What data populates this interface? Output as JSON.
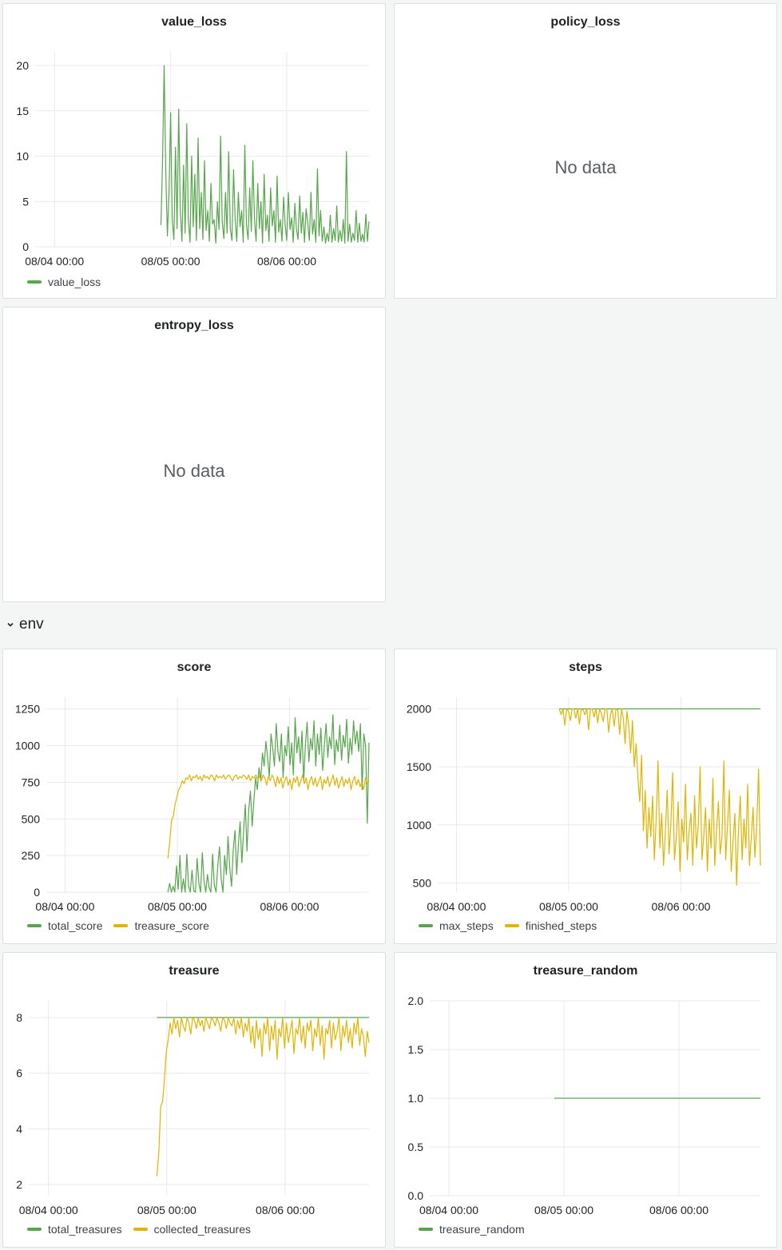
{
  "row": {
    "title": "env",
    "chevron_icon": "chevron-down-icon"
  },
  "no_data_text": "No data",
  "colors": {
    "green": "#56a64b",
    "yellow": "#e0b400",
    "grid": "#e9e9ea",
    "tick": "#202226"
  },
  "panels": [
    {
      "id": "value_loss",
      "title": "value_loss",
      "nodata": false,
      "chart_data": {
        "type": "line",
        "title": "value_loss",
        "xlabel": "",
        "ylabel": "",
        "x_ticks": [
          "08/04 00:00",
          "08/05 00:00",
          "08/06 00:00"
        ],
        "x_range": [
          "2023-08-03 20:00",
          "2023-08-06 17:00"
        ],
        "y_ticks": [
          "0",
          "5",
          "10",
          "15",
          "20"
        ],
        "ylim": [
          0,
          21.5
        ],
        "series": [
          {
            "name": "value_loss",
            "color": "#56a64b",
            "x_range": [
              "2023-08-04 22:00",
              "2023-08-06 17:00"
            ],
            "values": [
              2.4,
              9.5,
              20,
              8,
              1.2,
              6,
              14.8,
              3,
              0.8,
              11,
              2,
              15.2,
              4,
              0.6,
              9,
              1.5,
              13.6,
              3,
              0.5,
              10,
              2.2,
              8,
              0.7,
              12,
              2,
              6,
              0.8,
              9.5,
              1.8,
              4,
              0.6,
              7,
              2.5,
              3,
              0.4,
              5,
              1.9,
              12.2,
              2.8,
              0.9,
              6,
              1.5,
              10.5,
              2,
              0.7,
              8.5,
              3,
              0.6,
              6,
              2.2,
              4,
              0.5,
              11.2,
              2.5,
              0.8,
              6.5,
              1.7,
              9.5,
              3,
              0.6,
              7,
              2,
              5,
              0.4,
              8,
              1.8,
              3.5,
              0.6,
              6.5,
              2.3,
              4,
              0.5,
              7.8,
              1.6,
              3,
              0.6,
              5.5,
              2.4,
              0.7,
              6,
              1.9,
              3.2,
              0.5,
              4.8,
              2,
              0.8,
              5.6,
              1.5,
              3.8,
              0.5,
              4.2,
              2.6,
              0.7,
              6,
              1.4,
              3,
              0.5,
              8.6,
              1.2,
              4,
              0.6,
              2.2,
              0.4,
              1.5,
              0.6,
              3.5,
              0.5,
              2,
              0.7,
              4.5,
              0.5,
              1.8,
              0.6,
              3,
              0.4,
              10.5,
              0.6,
              2.5,
              0.5,
              1.5,
              0.7,
              4,
              0.5,
              2.6,
              0.6,
              1.4,
              0.5,
              3.6,
              0.6,
              2.8
            ]
          }
        ],
        "legend": [
          "value_loss"
        ],
        "grid": true
      }
    },
    {
      "id": "policy_loss",
      "title": "policy_loss",
      "nodata": true
    },
    {
      "id": "entropy_loss",
      "title": "entropy_loss",
      "nodata": true
    },
    {
      "id": "score",
      "title": "score",
      "nodata": false,
      "chart_data": {
        "type": "line",
        "title": "score",
        "xlabel": "",
        "ylabel": "",
        "x_ticks": [
          "08/04 00:00",
          "08/05 00:00",
          "08/06 00:00"
        ],
        "x_range": [
          "2023-08-03 20:00",
          "2023-08-06 17:00"
        ],
        "y_ticks": [
          "0",
          "250",
          "500",
          "750",
          "1000",
          "1250"
        ],
        "ylim": [
          0,
          1330
        ],
        "series": [
          {
            "name": "total_score",
            "color": "#56a64b",
            "x_range": [
              "2023-08-04 22:00",
              "2023-08-06 17:00"
            ],
            "values": [
              0,
              60,
              0,
              40,
              0,
              180,
              20,
              250,
              0,
              90,
              0,
              260,
              40,
              0,
              150,
              10,
              0,
              230,
              60,
              0,
              270,
              80,
              0,
              120,
              30,
              0,
              260,
              50,
              0,
              180,
              310,
              90,
              0,
              250,
              120,
              380,
              160,
              40,
              290,
              420,
              120,
              330,
              480,
              200,
              410,
              600,
              280,
              560,
              690,
              450,
              620,
              780,
              700,
              850,
              760,
              950,
              860,
              1030,
              920,
              790,
              1080,
              980,
              860,
              1150,
              960,
              890,
              1080,
              780,
              1000,
              930,
              1130,
              870,
              1020,
              800,
              1190,
              950,
              1060,
              880,
              1100,
              760,
              1010,
              1160,
              890,
              1050,
              970,
              1170,
              860,
              1080,
              940,
              1120,
              830,
              1000,
              1150,
              920,
              1060,
              980,
              1210,
              870,
              1040,
              960,
              1140,
              900,
              1070,
              990,
              1180,
              880,
              1050,
              940,
              1170,
              1010,
              1100,
              960,
              1150,
              700,
              1080,
              1000,
              470,
              1020
            ]
          },
          {
            "name": "treasure_score",
            "color": "#e0b400",
            "x_range": [
              "2023-08-04 22:00",
              "2023-08-06 17:00"
            ],
            "values": [
              230,
              340,
              490,
              520,
              600,
              650,
              700,
              720,
              760,
              740,
              780,
              770,
              800,
              760,
              790,
              780,
              800,
              770,
              790,
              760,
              800,
              780,
              790,
              770,
              800,
              790,
              760,
              800,
              780,
              790,
              780,
              800,
              770,
              790,
              800,
              780,
              760,
              790,
              800,
              770,
              790,
              780,
              800,
              790,
              770,
              800,
              760,
              790,
              780,
              800,
              770,
              790,
              760,
              800,
              780,
              730,
              790,
              760,
              800,
              770,
              720,
              790,
              740,
              780,
              710,
              760,
              790,
              730,
              770,
              700,
              780,
              750,
              790,
              720,
              760,
              800,
              740,
              780,
              700,
              760,
              790,
              730,
              780,
              720,
              760,
              790,
              700,
              770,
              740,
              790,
              720,
              760,
              800,
              730,
              780,
              710,
              750,
              790,
              720,
              770,
              740,
              780,
              700,
              760,
              790,
              730,
              770,
              720,
              750,
              700,
              780,
              740,
              760
            ]
          }
        ],
        "legend": [
          "total_score",
          "treasure_score"
        ],
        "grid": true
      }
    },
    {
      "id": "steps",
      "title": "steps",
      "nodata": false,
      "chart_data": {
        "type": "line",
        "title": "steps",
        "xlabel": "",
        "ylabel": "",
        "x_ticks": [
          "08/04 00:00",
          "08/05 00:00",
          "08/06 00:00"
        ],
        "x_range": [
          "2023-08-03 20:00",
          "2023-08-06 17:00"
        ],
        "y_ticks": [
          "500",
          "1000",
          "1500",
          "2000"
        ],
        "ylim": [
          420,
          2100
        ],
        "series": [
          {
            "name": "max_steps",
            "color": "#56a64b",
            "x_range": [
              "2023-08-04 22:00",
              "2023-08-06 17:00"
            ],
            "values": [
              2000,
              2000
            ]
          },
          {
            "name": "finished_steps",
            "color": "#e0b400",
            "x_range": [
              "2023-08-04 22:00",
              "2023-08-06 17:00"
            ],
            "values": [
              2000,
              1950,
              2000,
              1860,
              2000,
              1980,
              1900,
              2000,
              2000,
              1920,
              2000,
              1870,
              2000,
              1990,
              1950,
              2000,
              1820,
              2000,
              2000,
              1930,
              2000,
              1880,
              2000,
              1960,
              1890,
              2000,
              2000,
              1800,
              1950,
              2000,
              1850,
              2000,
              1990,
              1780,
              2000,
              1920,
              1700,
              1980,
              1850,
              1620,
              1900,
              1500,
              1700,
              1400,
              1200,
              1600,
              950,
              1300,
              800,
              1150,
              900,
              1250,
              700,
              1050,
              1550,
              800,
              1100,
              650,
              950,
              1300,
              750,
              1000,
              1450,
              700,
              900,
              1200,
              600,
              1050,
              850,
              1350,
              700,
              950,
              1100,
              650,
              1250,
              800,
              1000,
              1500,
              700,
              900,
              1150,
              600,
              1050,
              800,
              1400,
              650,
              950,
              1200,
              750,
              900,
              1550,
              700,
              1000,
              1300,
              600,
              850,
              1100,
              480,
              950,
              1250,
              700,
              1050,
              800,
              1350,
              650,
              900,
              1150,
              720,
              1000,
              1480,
              650
            ]
          }
        ],
        "legend": [
          "max_steps",
          "finished_steps"
        ],
        "grid": true
      }
    },
    {
      "id": "treasure",
      "title": "treasure",
      "nodata": false,
      "chart_data": {
        "type": "line",
        "title": "treasure",
        "xlabel": "",
        "ylabel": "",
        "x_ticks": [
          "08/04 00:00",
          "08/05 00:00",
          "08/06 00:00"
        ],
        "x_range": [
          "2023-08-03 20:00",
          "2023-08-06 17:00"
        ],
        "y_ticks": [
          "2",
          "4",
          "6",
          "8"
        ],
        "ylim": [
          1.6,
          8.6
        ],
        "series": [
          {
            "name": "total_treasures",
            "color": "#56a64b",
            "x_range": [
              "2023-08-04 22:00",
              "2023-08-06 17:00"
            ],
            "values": [
              8,
              8
            ]
          },
          {
            "name": "collected_treasures",
            "color": "#e0b400",
            "x_range": [
              "2023-08-04 22:00",
              "2023-08-06 17:00"
            ],
            "values": [
              2.3,
              3.2,
              4.8,
              5,
              5.8,
              6.8,
              7.2,
              7.8,
              7.4,
              8,
              7.6,
              7.9,
              7.3,
              8,
              7.7,
              7.5,
              8,
              7.8,
              7.4,
              8,
              7.9,
              7.6,
              8,
              7.7,
              7.9,
              7.5,
              8,
              7.8,
              7.6,
              8,
              7.9,
              7.7,
              8,
              7.8,
              7.5,
              8,
              7.9,
              7.6,
              8,
              7.8,
              7.7,
              8,
              7.4,
              7.9,
              7.6,
              8,
              7.3,
              7.8,
              7.5,
              8,
              7.1,
              7.7,
              6.9,
              7.9,
              7.2,
              7.6,
              6.6,
              7.8,
              7.4,
              8,
              6.8,
              7.7,
              7.2,
              7.9,
              6.5,
              7.6,
              7.3,
              8,
              6.9,
              7.8,
              7.1,
              7.5,
              7.9,
              6.7,
              7.6,
              7.4,
              8,
              7.1,
              7.7,
              6.9,
              7.8,
              7.5,
              7.9,
              6.8,
              7.6,
              7.3,
              8,
              7,
              7.7,
              6.5,
              7.6,
              7.4,
              7.9,
              6.9,
              7.8,
              7.2,
              7.5,
              8,
              6.8,
              7.7,
              7.3,
              7.9,
              7.1,
              7.6,
              6.9,
              7.8,
              7.4,
              8,
              7,
              7.6,
              7.3,
              6.6,
              7.5,
              7.1
            ]
          }
        ],
        "legend": [
          "total_treasures",
          "collected_treasures"
        ],
        "grid": true
      }
    },
    {
      "id": "treasure_random",
      "title": "treasure_random",
      "nodata": false,
      "chart_data": {
        "type": "line",
        "title": "treasure_random",
        "xlabel": "",
        "ylabel": "",
        "x_ticks": [
          "08/04 00:00",
          "08/05 00:00",
          "08/06 00:00"
        ],
        "x_range": [
          "2023-08-03 20:00",
          "2023-08-06 17:00"
        ],
        "y_ticks": [
          "0.0",
          "0.5",
          "1.0",
          "1.5",
          "2.0"
        ],
        "ylim": [
          0,
          2.0
        ],
        "series": [
          {
            "name": "treasure_random",
            "color": "#56a64b",
            "x_range": [
              "2023-08-04 22:00",
              "2023-08-06 17:00"
            ],
            "values": [
              1.0,
              1.0
            ]
          }
        ],
        "legend": [
          "treasure_random"
        ],
        "grid": true
      }
    }
  ]
}
